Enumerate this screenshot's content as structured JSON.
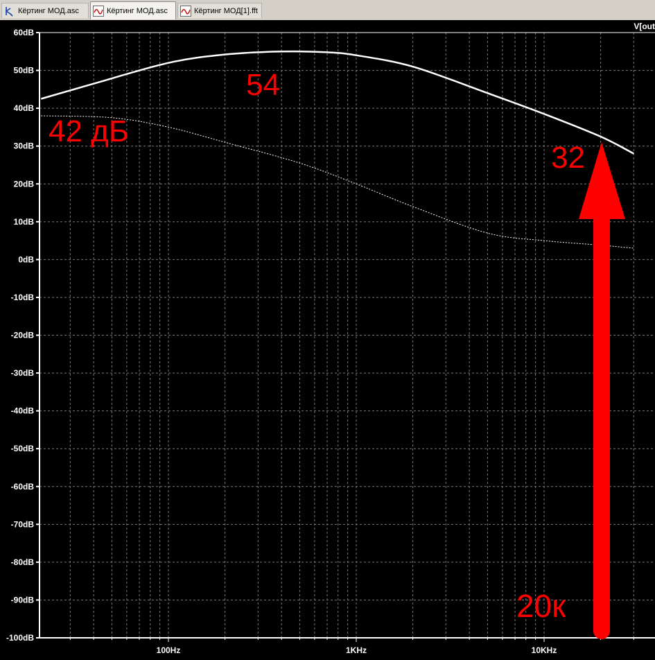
{
  "tabs": [
    {
      "label": "Кёртинг МОД.asc",
      "icon": "schematic-icon"
    },
    {
      "label": "Кёртинг МОД.asc",
      "icon": "waveform-icon"
    },
    {
      "label": "Кёртинг МОД[1].fft",
      "icon": "waveform-icon"
    }
  ],
  "trace_label": "V[out",
  "annotations": {
    "peak": "54",
    "low_start": "42 дБ",
    "at_20k": "32",
    "freq_20k": "20к"
  },
  "colors": {
    "background": "#000000",
    "grid": "#7a7a7a",
    "trace": "#ffffff",
    "annotation": "#ff0000"
  },
  "chart_data": {
    "type": "line",
    "xscale": "log",
    "xlim": [
      20,
      30000
    ],
    "ylim": [
      -100,
      60
    ],
    "ylabel_unit": "dB",
    "x_ticks": [
      "100Hz",
      "1KHz",
      "10KHz"
    ],
    "y_ticks": [
      "60dB",
      "50dB",
      "40dB",
      "30dB",
      "20dB",
      "10dB",
      "0dB",
      "-10dB",
      "-20dB",
      "-30dB",
      "-40dB",
      "-50dB",
      "-60dB",
      "-70dB",
      "-80dB",
      "-90dB",
      "-100dB"
    ],
    "grid": true,
    "series": [
      {
        "style": "solid",
        "x": [
          21,
          40,
          100,
          200,
          400,
          700,
          1000,
          2000,
          5000,
          10000,
          20000,
          30000
        ],
        "y": [
          42.5,
          46.5,
          52,
          54.2,
          55,
          54.8,
          54,
          51,
          44,
          38.5,
          32.5,
          28
        ]
      },
      {
        "style": "dotted",
        "x": [
          21,
          50,
          100,
          200,
          500,
          1000,
          2000,
          5000,
          10000,
          20000,
          30000
        ],
        "y": [
          38,
          37.5,
          35,
          31,
          25.5,
          20,
          14,
          7,
          5,
          3.8,
          3
        ]
      }
    ]
  }
}
